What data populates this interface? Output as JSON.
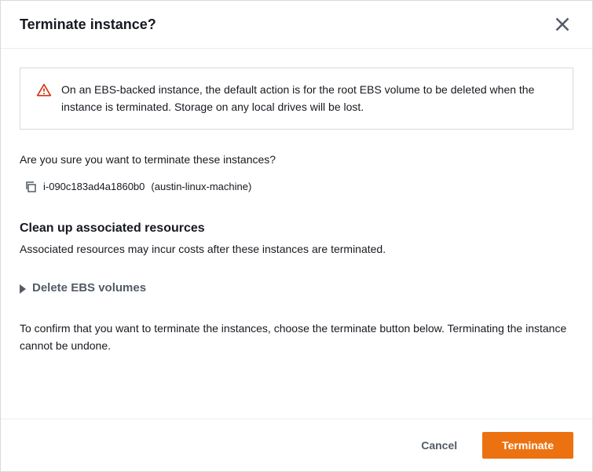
{
  "header": {
    "title": "Terminate instance?"
  },
  "warning": {
    "text": "On an EBS-backed instance, the default action is for the root EBS volume to be deleted when the instance is terminated. Storage on any local drives will be lost."
  },
  "confirm": {
    "question": "Are you sure you want to terminate these instances?",
    "instance_id": "i-090c183ad4a1860b0",
    "instance_name": "(austin-linux-machine)"
  },
  "cleanup": {
    "heading": "Clean up associated resources",
    "description": "Associated resources may incur costs after these instances are terminated."
  },
  "expandable": {
    "label": "Delete EBS volumes"
  },
  "final": {
    "text": "To confirm that you want to terminate the instances, choose the terminate button below. Terminating the instance cannot be undone."
  },
  "footer": {
    "cancel": "Cancel",
    "terminate": "Terminate"
  }
}
